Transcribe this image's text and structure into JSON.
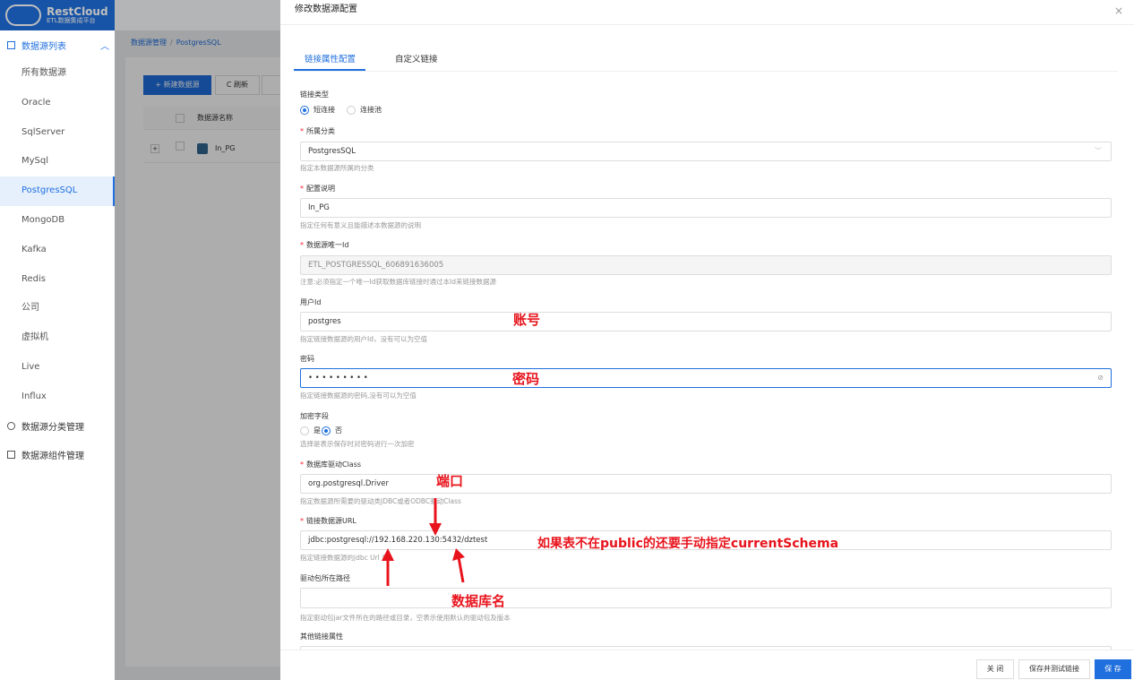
{
  "sidebar": {
    "logo": {
      "name": "RestCloud",
      "sub": "ETL数据集成平台"
    },
    "group1": "数据源列表",
    "items": [
      "所有数据源",
      "Oracle",
      "SqlServer",
      "MySql",
      "PostgresSQL",
      "MongoDB",
      "Kafka",
      "Redis",
      "公司",
      "虚拟机",
      "Live",
      "Influx"
    ],
    "active_index": 4,
    "group2": "数据源分类管理",
    "group3": "数据源组件管理"
  },
  "breadcrumb": {
    "root": "数据源管理",
    "current": "PostgresSQL"
  },
  "toolbar": {
    "new_label": "+ 新建数据源",
    "refresh_label": "C 刷新"
  },
  "table": {
    "header_name": "数据源名称",
    "rows": [
      {
        "name": "In_PG"
      }
    ]
  },
  "drawer": {
    "title": "修改数据源配置",
    "close": "×",
    "tabs": [
      "链接属性配置",
      "自定义链接"
    ],
    "fields": {
      "link_type": {
        "label": "链接类型",
        "opt1": "短连接",
        "opt2": "连接池"
      },
      "category": {
        "label": "所属分类",
        "value": "PostgresSQL",
        "hint": "指定本数据源所属的分类"
      },
      "description": {
        "label": "配置说明",
        "value": "In_PG",
        "hint": "指定任何有意义且能描述本数据源的说明"
      },
      "unique_id": {
        "label": "数据源唯一Id",
        "value": "ETL_POSTGRESSQL_606891636005",
        "hint": "注意:必须指定一个唯一Id获取数据库链接时通过本Id来链接数据源"
      },
      "user": {
        "label": "用户Id",
        "value": "postgres",
        "hint": "指定链接数据源的用户Id，没有可以为空值"
      },
      "password": {
        "label": "密码",
        "value": "• • • • • • • • •",
        "hint": "指定链接数据源的密码,没有可以为空值"
      },
      "encrypt": {
        "label": "加密字段",
        "opt1": "是",
        "opt2": "否",
        "hint": "选择是表示保存时对密码进行一次加密"
      },
      "driver": {
        "label": "数据库驱动Class",
        "value": "org.postgresql.Driver",
        "hint": "指定数据源所需要的驱动类JDBC或者ODBC驱动Class"
      },
      "url": {
        "label": "链接数据源URL",
        "value": "jdbc:postgresql://192.168.220.130:5432/dztest",
        "hint": "指定链接数据源的jdbc Url 页"
      },
      "driver_path": {
        "label": "驱动包所在路径",
        "value": "",
        "hint": "指定驱动包jar文件所在的路径或目录，空表示使用默认的驱动包及版本"
      },
      "other": {
        "label": "其他链接属性"
      }
    },
    "annotations": {
      "account": "账号",
      "password": "密码",
      "port": "端口",
      "schema_note": "如果表不在public的还要手动指定currentSchema",
      "dbname": "数据库名"
    },
    "footer": {
      "close": "关 闭",
      "save_test": "保存并测试链接",
      "save": "保 存"
    }
  }
}
